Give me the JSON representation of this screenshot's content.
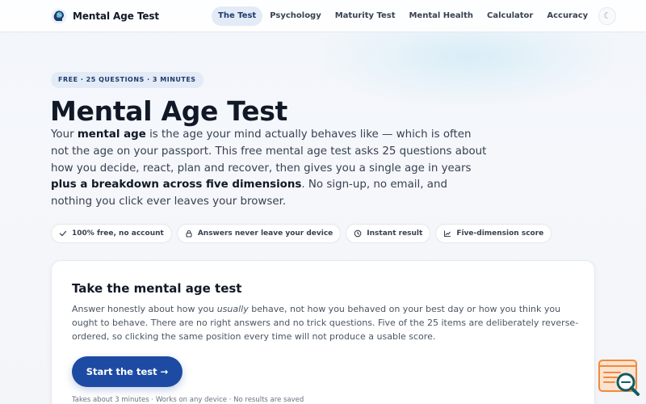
{
  "header": {
    "brand_name": "Mental Age Test",
    "nav": [
      {
        "label": "The Test",
        "active": true
      },
      {
        "label": "Psychology",
        "active": false
      },
      {
        "label": "Maturity Test",
        "active": false
      },
      {
        "label": "Mental Health",
        "active": false
      },
      {
        "label": "Calculator",
        "active": false
      },
      {
        "label": "Accuracy",
        "active": false
      }
    ],
    "theme_toggle_glyph": "☾"
  },
  "hero": {
    "badge": "FREE · 25 QUESTIONS · 3 MINUTES",
    "title": "Mental Age Test",
    "lead": {
      "p1": "Your ",
      "b1": "mental age",
      "p2": " is the age your mind actually behaves like — which is often not the age on your passport. This free mental age test asks 25 questions about how you decide, react, plan and recover, then gives you a single age in years ",
      "b2": "plus a breakdown across five dimensions",
      "p3": ". No sign-up, no email, and nothing you click ever leaves your browser."
    },
    "pills": [
      {
        "icon": "check-icon",
        "label": "100% free, no account"
      },
      {
        "icon": "lock-icon",
        "label": "Answers never leave your device"
      },
      {
        "icon": "clock-icon",
        "label": "Instant result"
      },
      {
        "icon": "chart-icon",
        "label": "Five-dimension score"
      }
    ]
  },
  "card": {
    "title": "Take the mental age test",
    "text": {
      "p1": "Answer honestly about how you ",
      "em": "usually",
      "p2": " behave, not how you behaved on your best day or how you think you ought to behave. There are no right answers and no trick questions. Five of the 25 items are deliberately reverse-ordered, so clicking the same position every time will not produce a usable score."
    },
    "button_label": "Start the test →",
    "note": "Takes about 3 minutes · Works on any device · No results are saved"
  },
  "colors": {
    "accent": "#1d4ba3",
    "badge_bg": "#e3ebf6",
    "badge_text": "#1e3a6e",
    "widget_orange": "#f08a3c",
    "widget_teal": "#0f5c63"
  }
}
